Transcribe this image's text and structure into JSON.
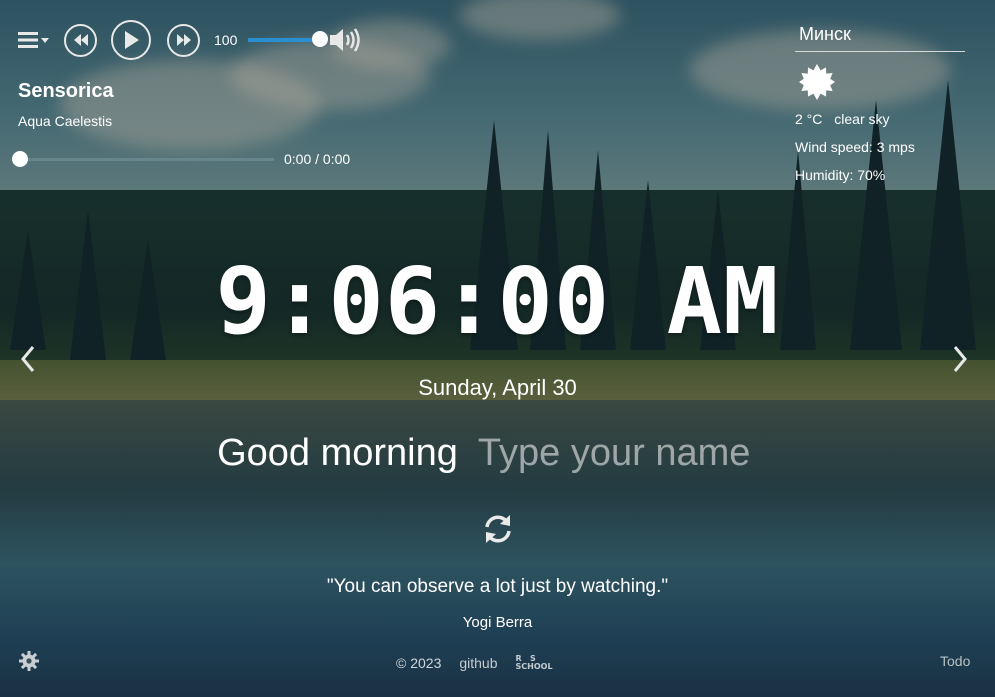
{
  "player": {
    "playlist_icon": "playlist-menu-icon",
    "prev_icon": "rewind-icon",
    "play_icon": "play-icon",
    "next_icon": "fast-forward-icon",
    "volume_value": "100",
    "volume_level": 1.0,
    "volume_icon": "speaker-icon",
    "track_title": "Sensorica",
    "track_artist": "Aqua Caelestis",
    "progress": 0,
    "time_text": "0:00 / 0:00"
  },
  "weather": {
    "city": "Минск",
    "icon": "sun-icon",
    "temperature": "2 °C",
    "description": "clear sky",
    "wind": "Wind speed: 3 mps",
    "humidity": "Humidity: 70%"
  },
  "clock": {
    "time": "9:06:00 AM",
    "date": "Sunday, April 30"
  },
  "greeting": {
    "text": "Good morning",
    "name_placeholder": "Type your name"
  },
  "quote": {
    "text": "\"You can observe a lot just by watching.\"",
    "author": "Yogi Berra"
  },
  "footer": {
    "copyright": "© 2023",
    "github": "github",
    "todo": "Todo"
  },
  "colors": {
    "accent": "#2a8fd0",
    "text": "#ffffff"
  }
}
